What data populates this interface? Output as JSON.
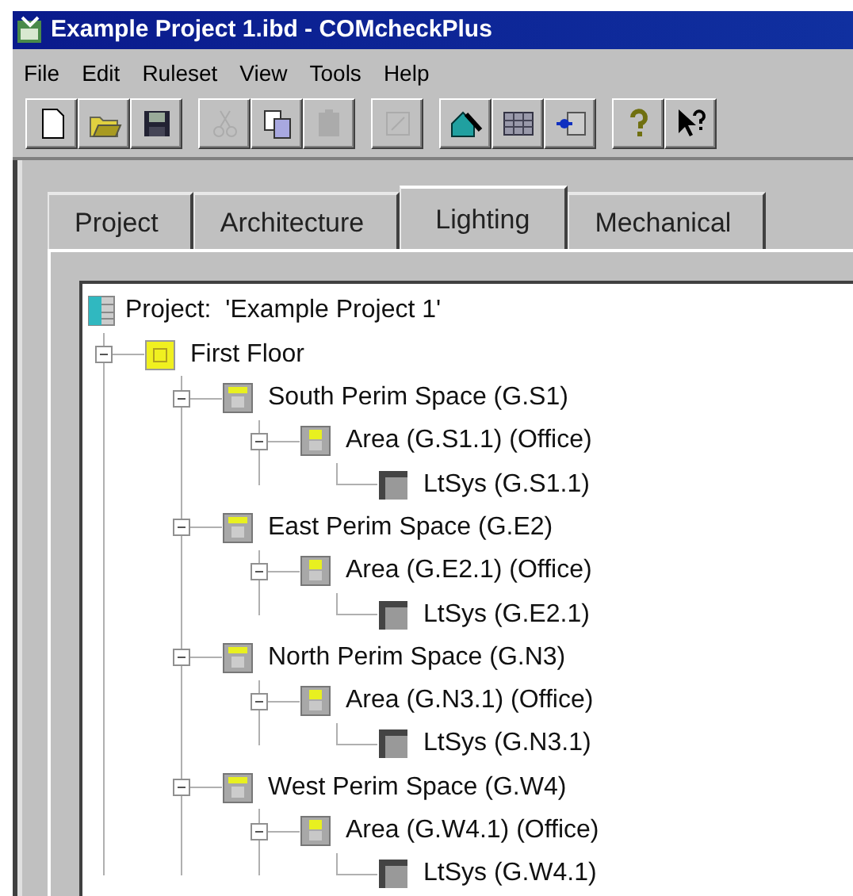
{
  "window": {
    "title": "Example Project 1.ibd - COMcheckPlus"
  },
  "menu": [
    "File",
    "Edit",
    "Ruleset",
    "View",
    "Tools",
    "Help"
  ],
  "toolbar": [
    [
      {
        "kind": "new",
        "disabled": false
      },
      {
        "kind": "open",
        "disabled": false
      },
      {
        "kind": "save",
        "disabled": false
      }
    ],
    [
      {
        "kind": "cut",
        "disabled": true
      },
      {
        "kind": "copy",
        "disabled": false
      },
      {
        "kind": "paste",
        "disabled": true
      }
    ],
    [
      {
        "kind": "edit",
        "disabled": true
      }
    ],
    [
      {
        "kind": "building",
        "disabled": false
      },
      {
        "kind": "table",
        "disabled": false
      },
      {
        "kind": "arrow",
        "disabled": false
      }
    ],
    [
      {
        "kind": "help",
        "disabled": false
      },
      {
        "kind": "whatsthis",
        "disabled": false
      }
    ]
  ],
  "tabs": [
    {
      "label": "Project",
      "selected": false
    },
    {
      "label": "Architecture",
      "selected": false
    },
    {
      "label": "Lighting",
      "selected": true
    },
    {
      "label": "Mechanical",
      "selected": false
    }
  ],
  "tree": {
    "kind": "project",
    "label": "Project:  'Example Project 1'",
    "children": [
      {
        "kind": "floor",
        "label": "First Floor",
        "expanded": true,
        "children": [
          {
            "kind": "space",
            "label": "South Perim Space (G.S1)",
            "expanded": true,
            "children": [
              {
                "kind": "area",
                "label": "Area (G.S1.1) (Office)",
                "expanded": true,
                "children": [
                  {
                    "kind": "ltsys",
                    "label": "LtSys (G.S1.1)"
                  }
                ]
              }
            ]
          },
          {
            "kind": "space",
            "label": "East Perim Space (G.E2)",
            "expanded": true,
            "children": [
              {
                "kind": "area",
                "label": "Area (G.E2.1) (Office)",
                "expanded": true,
                "children": [
                  {
                    "kind": "ltsys",
                    "label": "LtSys (G.E2.1)"
                  }
                ]
              }
            ]
          },
          {
            "kind": "space",
            "label": "North Perim Space (G.N3)",
            "expanded": true,
            "children": [
              {
                "kind": "area",
                "label": "Area (G.N3.1) (Office)",
                "expanded": true,
                "children": [
                  {
                    "kind": "ltsys",
                    "label": "LtSys (G.N3.1)"
                  }
                ]
              }
            ]
          },
          {
            "kind": "space",
            "label": "West Perim Space (G.W4)",
            "expanded": true,
            "children": [
              {
                "kind": "area",
                "label": "Area (G.W4.1) (Office)",
                "expanded": true,
                "children": [
                  {
                    "kind": "ltsys",
                    "label": "LtSys (G.W4.1)"
                  }
                ]
              }
            ]
          }
        ]
      }
    ]
  }
}
